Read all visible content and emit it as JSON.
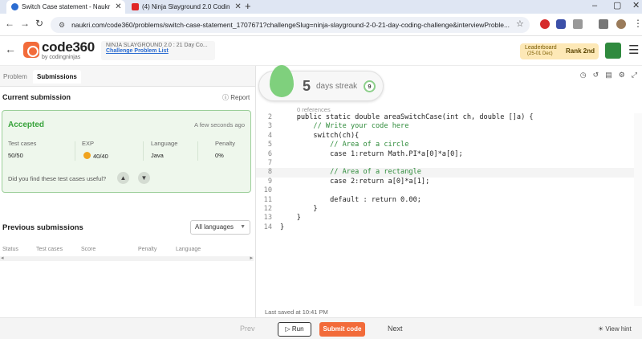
{
  "browser": {
    "tabs": [
      {
        "title": "Switch Case statement - Naukr",
        "favicon_color": "#2b6cd1",
        "active": true
      },
      {
        "title": "(4) Ninja Slayground 2.0 Codin",
        "favicon_color": "#e02626",
        "active": false
      }
    ],
    "new_tab": "+",
    "url": "naukri.com/code360/problems/switch-case-statement_1707671?challengeSlug=ninja-slayground-2-0-21-day-coding-challenge&interviewProble..."
  },
  "header": {
    "logo_main": "code360",
    "logo_sub": "by codingninjas",
    "event_title": "NINJA SLAYGROUND 2.0 : 21 Day Co...",
    "event_link": "Challenge Problem List",
    "leaderboard_label": "Leaderboard",
    "leaderboard_date": "(25-01 Dec)",
    "rank": "Rank 2nd"
  },
  "left": {
    "tabs": [
      "Problem",
      "Submissions"
    ],
    "current_title": "Current submission",
    "report": "Report",
    "status": "Accepted",
    "time_ago": "A few seconds ago",
    "stats": [
      {
        "label": "Test cases",
        "value": "50/50"
      },
      {
        "label": "EXP",
        "value": "40/40"
      },
      {
        "label": "Language",
        "value": "Java"
      },
      {
        "label": "Penalty",
        "value": "0%"
      }
    ],
    "useful_question": "Did you find these test cases useful?",
    "previous_title": "Previous submissions",
    "language_filter": "All languages",
    "columns": [
      "Status",
      "Test cases",
      "Score",
      "Penalty",
      "Language"
    ]
  },
  "streak": {
    "count": "5",
    "label": "days streak",
    "badge": "9"
  },
  "editor": {
    "references": "0 references",
    "lines": [
      {
        "n": "2",
        "text": "    public static double areaSwitchCase(int ch, double []a) {"
      },
      {
        "n": "3",
        "text": "        // Write your code here"
      },
      {
        "n": "4",
        "text": "        switch(ch){"
      },
      {
        "n": "5",
        "text": "            // Area of a circle"
      },
      {
        "n": "6",
        "text": "            case 1:return Math.PI*a[0]*a[0];"
      },
      {
        "n": "7",
        "text": ""
      },
      {
        "n": "8",
        "text": "            // Area of a rectangle"
      },
      {
        "n": "9",
        "text": "            case 2:return a[0]*a[1];"
      },
      {
        "n": "10",
        "text": ""
      },
      {
        "n": "11",
        "text": "            default : return 0.00;"
      },
      {
        "n": "12",
        "text": "        }"
      },
      {
        "n": "13",
        "text": "    }"
      },
      {
        "n": "14",
        "text": "}"
      }
    ],
    "last_saved": "Last saved at 10:41 PM"
  },
  "bottom": {
    "prev": "Prev",
    "run": "Run",
    "submit": "Submit code",
    "next": "Next",
    "view_hint": "View hint"
  },
  "colors": {
    "accent": "#f26b3a",
    "accepted": "#38a33b",
    "leaderboard_bg": "#fde8b6"
  }
}
